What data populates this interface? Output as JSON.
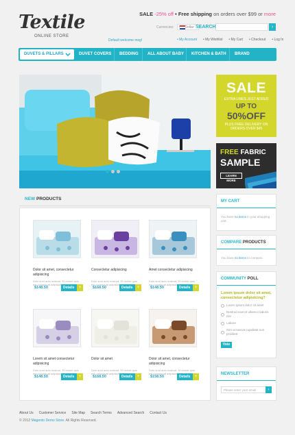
{
  "brand": {
    "logo": "Textile",
    "tagline": "ONLINE STORE"
  },
  "top_promo": {
    "sale": "SALE",
    "discount": "-25% off",
    "shipping": "• Free shipping",
    "suffix": "on orders over $99 or",
    "more": "more"
  },
  "currency": {
    "label": "Currencies:",
    "selected": "US Dollar"
  },
  "search": {
    "label": "SEARCH",
    "placeholder": "",
    "button": "›"
  },
  "welcome": "Default welcome msg!",
  "top_links": [
    "• My Account",
    "• My Wishlist",
    "• My Cart",
    "• Checkout",
    "• Log In"
  ],
  "nav": {
    "items": [
      "DUVETS & PILLARS",
      "DUVET COVERS",
      "BEDDING",
      "ALL ABOUT BABY",
      "KITCHEN & BATH",
      "BRAND"
    ],
    "first_icon": "chevron-down-icon"
  },
  "banners": {
    "sale": {
      "title": "SALE",
      "l1": "EXTRA LINES JUST ADDED",
      "l2": "UP TO",
      "l3": "50%OFF",
      "l4": "PLUS FREE DELIVERY ON",
      "l5": "ORDERS OVER $45"
    },
    "sample": {
      "title1": "FREE",
      "title2": "FABRIC",
      "title3": "SAMPLE",
      "button": "LEARN MORE"
    }
  },
  "new_products": {
    "title_accent": "NEW",
    "title_rest": "PRODUCTS",
    "details_label": "Details",
    "plus_label": "+",
    "items": [
      {
        "name": "Dolor sit amet, consectetur adipisicing",
        "desc": "Dolo sunt auto nostrud. Et dolore quis est consequat adipisicing",
        "price": "$148.50"
      },
      {
        "name": "Consectetur adipisicing",
        "desc": "Dolo sunt auto nostrud. Et dolore quis est consequat adipisicing",
        "price": "$168.50"
      },
      {
        "name": "Amet consectetur adipisicing",
        "desc": "Dolo sunt auto nostrud. Et dolore quis est consequat adipisicing",
        "price": "$148.50"
      },
      {
        "name": "Lorem sit amet consectetur adipisicing",
        "desc": "Dolo sunt auto nostrud. Et dolore quis est consequat adipisicing",
        "price": "$148.50"
      },
      {
        "name": "Dolor sit amet",
        "desc": "Dolo sunt auto nostrud. Et dolore quis est consequat adipisicing",
        "price": "$168.50"
      },
      {
        "name": "Dolor sit amet, consectetur adipisicing",
        "desc": "Dolo sunt auto nostrud. Et dolore quis est consequat adipisicing",
        "price": "$158.50"
      }
    ]
  },
  "sidebar": {
    "cart": {
      "title": "MY CART",
      "pre": "You have ",
      "accent": "no items",
      "post": " in your shopping cart."
    },
    "compare": {
      "title_accent": "COMPARE",
      "title_rest": " PRODUCTS",
      "pre": "You have ",
      "accent": "no items",
      "post": " to compare."
    },
    "poll": {
      "title_accent": "COMMUNITY",
      "title_rest": " POLL",
      "question": "Lorem ipsum dolor sit amet, consectetur adipisicing?",
      "options": [
        "Lorem ipsum dolor sit amet",
        "Nostrud exercit ullamco laboris nisi",
        "Labore",
        "Sint occaecat cupidatat non proident"
      ],
      "vote": "Vote"
    },
    "newsletter": {
      "title": "NEWSLETTER",
      "placeholder": "Please enter your email"
    }
  },
  "footer": {
    "links": [
      "About Us",
      "Customer Service",
      "Site Map",
      "Search Terms",
      "Advanced Search",
      "Contact Us"
    ],
    "copyright_pre": "© 2012 ",
    "copyright_accent": "Magento Demo Store",
    "copyright_post": ". All Rights Reserved."
  },
  "colors": {
    "accent": "#22b3c7",
    "lime": "#d4d72b",
    "dark": "#2d2d2d"
  }
}
